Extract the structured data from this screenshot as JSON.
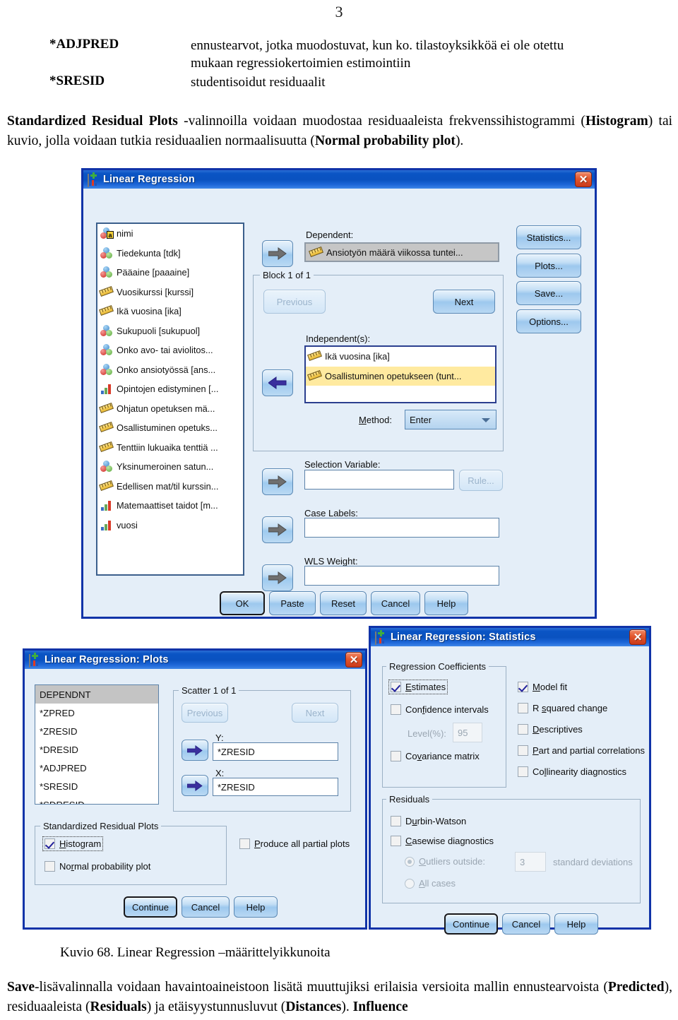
{
  "document": {
    "page_number": "3",
    "definitions": [
      {
        "term": "*ADJPRED",
        "desc_line1": "ennustearvot, jotka muodostuvat, kun ko. tilastoyksikköä ei ole otettu",
        "desc_line2": "mukaan regressiokertoimien estimointiin"
      },
      {
        "term": "*SRESID",
        "desc_line1": "studentisoidut residuaalit",
        "desc_line2": ""
      }
    ],
    "paragraph_main_p1": "Standardized Residual Plots",
    "paragraph_main_p2": " -valinnoilla voidaan muodostaa residuaaleista frekvenssihistogrammi (",
    "paragraph_main_p3": "Histogram",
    "paragraph_main_p4": ") tai kuvio, jolla voidaan tutkia residuaalien normaalisuutta (",
    "paragraph_main_p5": "Normal probability plot",
    "paragraph_main_p6": ").",
    "caption": "Kuvio 68. Linear Regression –määrittelyikkunoita",
    "paragraph_bottom_p1": "Save",
    "paragraph_bottom_p2": "-lisävalinnalla voidaan havaintoaineistoon lisätä muuttujiksi erilaisia versioita mallin ennustearvoista (",
    "paragraph_bottom_p3": "Predicted",
    "paragraph_bottom_p4": "), residuaaleista (",
    "paragraph_bottom_p5": "Residuals",
    "paragraph_bottom_p6": ") ja etäisyystunnusluvut (",
    "paragraph_bottom_p7": "Distances",
    "paragraph_bottom_p8": "). ",
    "paragraph_bottom_p9": "Influence"
  },
  "main_dialog": {
    "title": "Linear Regression",
    "close_label": "✕",
    "variables": [
      {
        "label": "nimi",
        "type": "nominal-string"
      },
      {
        "label": "Tiedekunta [tdk]",
        "type": "nominal"
      },
      {
        "label": "Pääaine [paaaine]",
        "type": "nominal"
      },
      {
        "label": "Vuosikurssi [kurssi]",
        "type": "scale"
      },
      {
        "label": "Ikä vuosina [ika]",
        "type": "scale"
      },
      {
        "label": "Sukupuoli [sukupuol]",
        "type": "nominal"
      },
      {
        "label": "Onko avo- tai aviolitos...",
        "type": "nominal"
      },
      {
        "label": "Onko ansiotyössä [ans...",
        "type": "nominal"
      },
      {
        "label": "Opintojen edistyminen [...",
        "type": "ordinal"
      },
      {
        "label": "Ohjatun opetuksen mä...",
        "type": "scale"
      },
      {
        "label": "Osallistuminen opetuks...",
        "type": "scale"
      },
      {
        "label": "Tenttiin lukuaika tenttiä ...",
        "type": "scale"
      },
      {
        "label": "Yksinumeroinen satun...",
        "type": "nominal"
      },
      {
        "label": "Edellisen mat/til kurssin...",
        "type": "scale"
      },
      {
        "label": "Matemaattiset taidot [m...",
        "type": "ordinal"
      },
      {
        "label": "vuosi",
        "type": "ordinal"
      }
    ],
    "dependent_label": "Dependent:",
    "dependent_value": "Ansiotyön määrä viikossa tuntei...",
    "block_group_label": "Block 1 of 1",
    "previous_label": "Previous",
    "next_label": "Next",
    "independents_label": "Independent(s):",
    "independents": [
      {
        "label": "Ikä vuosina [ika]",
        "type": "scale",
        "selected": false
      },
      {
        "label": "Osallistuminen opetukseen (tunt...",
        "type": "scale",
        "selected": true
      }
    ],
    "method_label": "Method:",
    "method_value": "Enter",
    "selection_variable_label": "Selection Variable:",
    "selection_variable_value": "",
    "rule_label": "Rule...",
    "case_labels_label": "Case Labels:",
    "case_labels_value": "",
    "wls_weight_label": "WLS Weight:",
    "wls_weight_value": "",
    "side_buttons": [
      "Statistics...",
      "Plots...",
      "Save...",
      "Options..."
    ],
    "bottom_buttons": [
      "OK",
      "Paste",
      "Reset",
      "Cancel",
      "Help"
    ]
  },
  "plots_dialog": {
    "title": "Linear Regression: Plots",
    "close_label": "✕",
    "source_items": [
      "DEPENDNT",
      "*ZPRED",
      "*ZRESID",
      "*DRESID",
      "*ADJPRED",
      "*SRESID",
      "*SDRESID"
    ],
    "selected_source_index": 0,
    "scatter_group_label": "Scatter 1 of 1",
    "previous_label": "Previous",
    "next_label": "Next",
    "y_label": "Y:",
    "y_value": "*ZRESID",
    "x_label": "X:",
    "x_value": "*ZRESID",
    "srp_group_label": "Standardized Residual Plots",
    "histogram_label": "Histogram",
    "histogram_checked": true,
    "normal_plot_label": "Normal probability plot",
    "normal_plot_checked": false,
    "partial_plots_label": "Produce all partial plots",
    "partial_plots_checked": false,
    "bottom_buttons": [
      "Continue",
      "Cancel",
      "Help"
    ]
  },
  "statistics_dialog": {
    "title": "Linear Regression: Statistics",
    "close_label": "✕",
    "coefficients_group_label": "Regression Coefficients",
    "estimates_label": "Estimates",
    "estimates_checked": true,
    "confidence_intervals_label": "Confidence intervals",
    "confidence_intervals_checked": false,
    "level_label": "Level(%):",
    "level_value": "95",
    "covariance_matrix_label": "Covariance matrix",
    "covariance_matrix_checked": false,
    "right_checks": [
      {
        "label": "Model fit",
        "checked": true
      },
      {
        "label": "R squared change",
        "checked": false
      },
      {
        "label": "Descriptives",
        "checked": false
      },
      {
        "label": "Part and partial correlations",
        "checked": false
      },
      {
        "label": "Collinearity diagnostics",
        "checked": false
      }
    ],
    "residuals_group_label": "Residuals",
    "durbin_watson_label": "Durbin-Watson",
    "durbin_watson_checked": false,
    "casewise_label": "Casewise diagnostics",
    "casewise_checked": false,
    "outliers_label": "Outliers outside:",
    "outliers_value": "3",
    "std_dev_label": "standard deviations",
    "all_cases_label": "All cases",
    "bottom_buttons": [
      "Continue",
      "Cancel",
      "Help"
    ]
  },
  "colors": {
    "titlebar_blue": "#0a54c4",
    "window_border": "#1033a8",
    "dialog_bg": "#e4eef8",
    "selected_row": "#ffeaa0",
    "grey_select": "#c4c4c4",
    "close_red": "#c9391a"
  }
}
